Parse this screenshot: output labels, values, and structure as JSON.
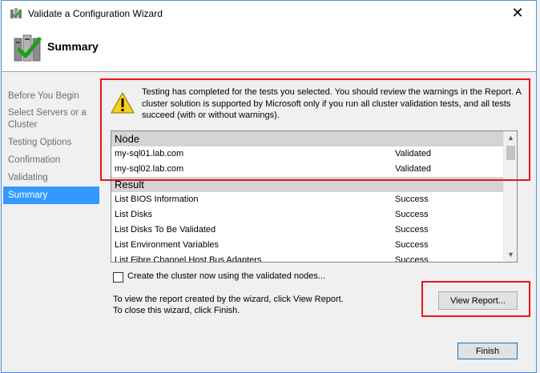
{
  "window": {
    "title": "Validate a Configuration Wizard",
    "close_glyph": "✕"
  },
  "header": {
    "title": "Summary"
  },
  "nav": {
    "items": [
      {
        "label": "Before You Begin"
      },
      {
        "label": "Select Servers or a Cluster"
      },
      {
        "label": "Testing Options"
      },
      {
        "label": "Confirmation"
      },
      {
        "label": "Validating"
      },
      {
        "label": "Summary"
      }
    ]
  },
  "warning": {
    "text": "Testing has completed for the tests you selected. You should review the warnings in the Report.  A cluster solution is supported by Microsoft only if you run all cluster validation tests, and all tests succeed (with or without warnings)."
  },
  "list": {
    "node_header": "Node",
    "nodes": [
      {
        "name": "my-sql01.lab.com",
        "status": "Validated"
      },
      {
        "name": "my-sql02.lab.com",
        "status": "Validated"
      }
    ],
    "result_header": "Result",
    "results": [
      {
        "name": "List BIOS Information",
        "status": "Success"
      },
      {
        "name": "List Disks",
        "status": "Success"
      },
      {
        "name": "List Disks To Be Validated",
        "status": "Success"
      },
      {
        "name": "List Environment Variables",
        "status": "Success"
      },
      {
        "name": "List Fibre Channel Host Bus Adapters",
        "status": "Success"
      }
    ]
  },
  "checkbox": {
    "label": "Create the cluster now using the validated nodes..."
  },
  "info": {
    "line1": "To view the report created by the wizard, click View Report.",
    "line2": "To close this wizard, click Finish."
  },
  "buttons": {
    "view_report": "View Report...",
    "finish": "Finish"
  }
}
